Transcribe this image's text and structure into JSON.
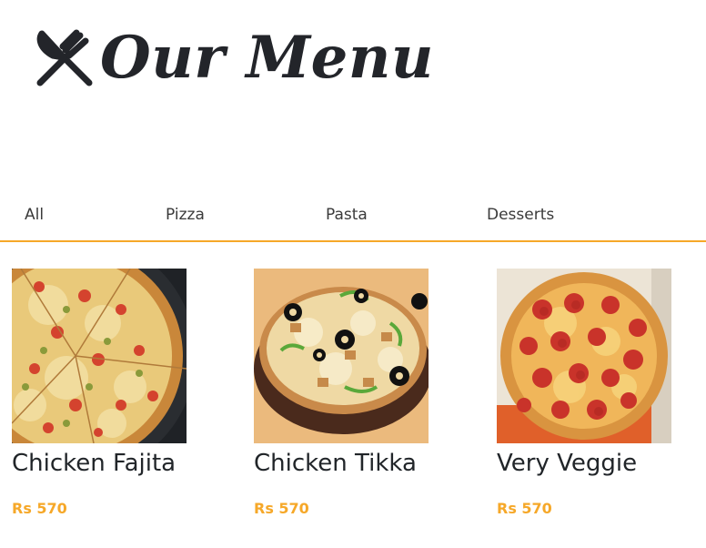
{
  "header": {
    "title": "Our Menu",
    "icon": "fork-knife-icon"
  },
  "tabs": [
    {
      "label": "All"
    },
    {
      "label": "Pizza"
    },
    {
      "label": "Pasta"
    },
    {
      "label": "Desserts"
    }
  ],
  "menu_items": [
    {
      "name": "Chicken Fajita",
      "price": "Rs 570",
      "image": "pizza-fajita-image"
    },
    {
      "name": "Chicken Tikka",
      "price": "Rs 570",
      "image": "pizza-tikka-image"
    },
    {
      "name": "Very Veggie",
      "price": "Rs 570",
      "image": "pizza-pepperoni-image"
    }
  ],
  "colors": {
    "accent": "#f6a829",
    "title": "#23252a",
    "text": "#212529"
  }
}
